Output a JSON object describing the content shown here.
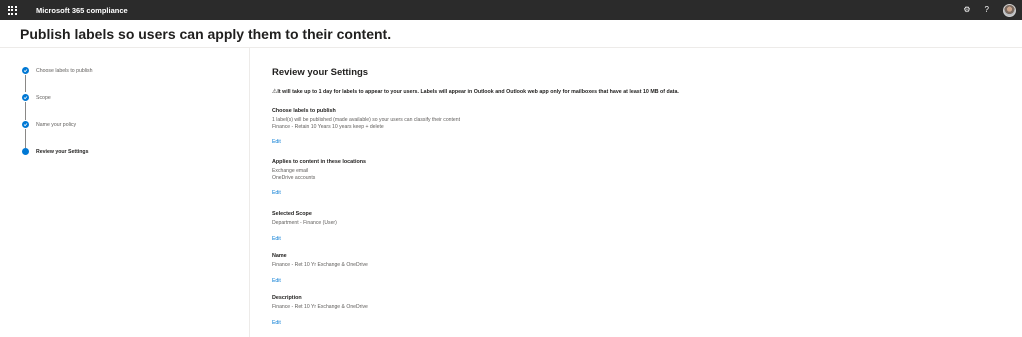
{
  "topbar": {
    "app_title": "Microsoft 365 compliance",
    "icons": [
      "app-launcher-icon",
      "settings-icon",
      "help-icon",
      "avatar"
    ],
    "help_glyph": "?",
    "settings_glyph": "⚙",
    "background": "#2b2b2b"
  },
  "page": {
    "title": "Publish labels so users can apply them to their content."
  },
  "wizard": {
    "steps": [
      {
        "label": "Choose labels to publish",
        "status": "completed"
      },
      {
        "label": "Scope",
        "status": "completed"
      },
      {
        "label": "Name your policy",
        "status": "completed"
      },
      {
        "label": "Review your Settings",
        "status": "current"
      }
    ],
    "accent": "#0078d4"
  },
  "review": {
    "title": "Review your Settings",
    "warning_icon": "⚠",
    "warning": "It will take up to 1 day for labels to appear to your users. Labels will appear in Outlook and Outlook web app only for mailboxes that have at least 10 MB of data.",
    "edit_label": "Edit",
    "groups": [
      {
        "title": "Choose labels to publish",
        "lines": [
          "1 label(s) will be published (made available) so your users can classify their content",
          "Finance - Retain 10 Years 10 years keep + delete"
        ]
      },
      {
        "title": "Applies to content in these locations",
        "lines": [
          "Exchange email",
          "OneDrive accounts"
        ]
      },
      {
        "title": "Selected Scope",
        "lines": [
          "Department - Finance (User)"
        ]
      },
      {
        "title": "Name",
        "lines": [
          "Finance - Ret 10 Yr Exchange & OneDrive"
        ]
      },
      {
        "title": "Description",
        "lines": [
          "Finance - Ret 10 Yr Exchange & OneDrive"
        ]
      }
    ]
  }
}
